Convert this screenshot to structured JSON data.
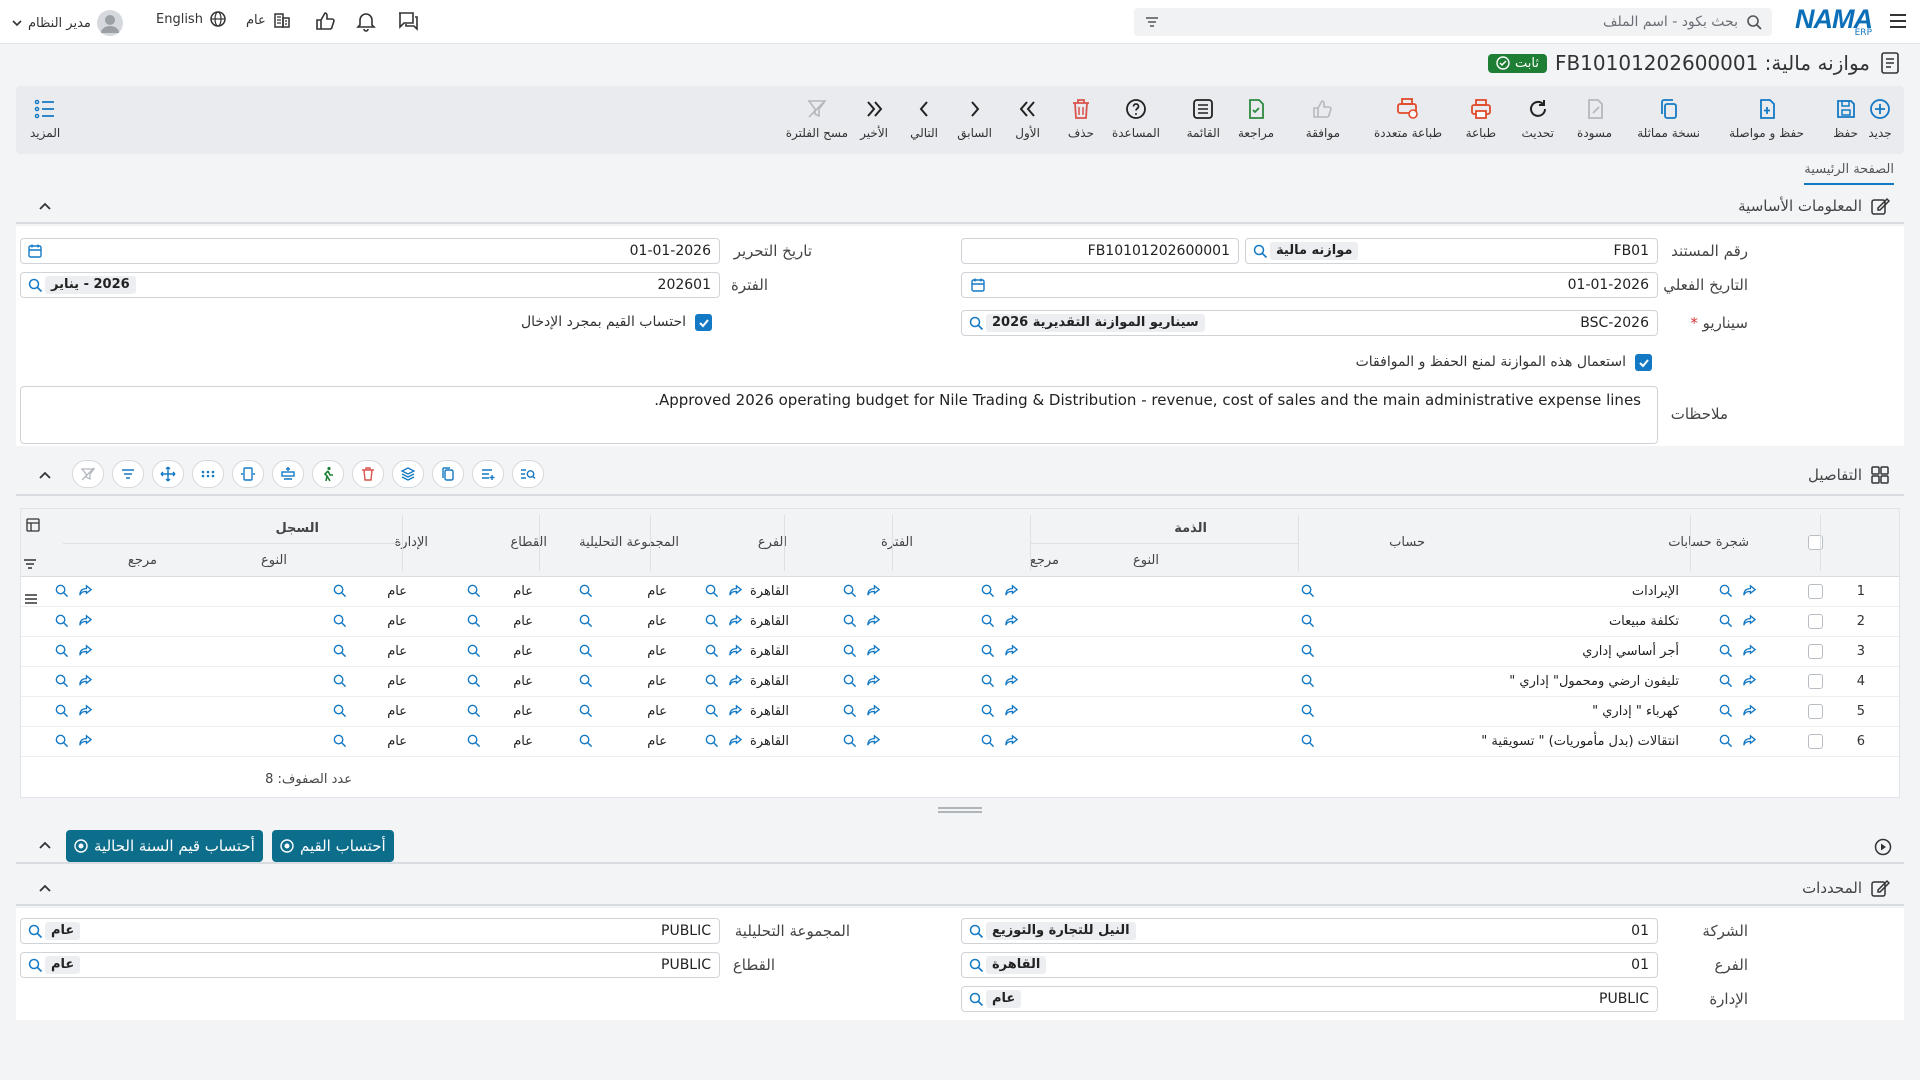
{
  "app": {
    "logo_text": "NAMA",
    "logo_sub": "ERP",
    "search_placeholder": "بحث بكود - اسم الملف",
    "language": "English",
    "scope": "عام",
    "user": "مدير النظام"
  },
  "document": {
    "title": "موازنه مالية: FB10101202600001",
    "status": "ثابت"
  },
  "toolbar": {
    "items": [
      {
        "label": "جديد",
        "icon": "plus-circle-icon"
      },
      {
        "label": "حفظ",
        "icon": "save-icon"
      },
      {
        "label": "حفظ و مواصلة",
        "icon": "save-continue-icon"
      },
      {
        "label": "نسخة مماثلة",
        "icon": "copy-icon"
      },
      {
        "label": "مسودة",
        "icon": "draft-icon"
      },
      {
        "label": "تحديث",
        "icon": "refresh-icon"
      },
      {
        "label": "طباعة",
        "icon": "print-icon"
      },
      {
        "label": "طباعة متعددة",
        "icon": "multi-print-icon"
      },
      {
        "label": "موافقة",
        "icon": "approve-icon"
      },
      {
        "label": "مراجعة",
        "icon": "review-icon"
      },
      {
        "label": "القائمة",
        "icon": "list-icon"
      },
      {
        "label": "المساعدة",
        "icon": "help-icon"
      },
      {
        "label": "حذف",
        "icon": "trash-icon"
      },
      {
        "label": "الأول",
        "icon": "first-icon"
      },
      {
        "label": "السابق",
        "icon": "previous-icon"
      },
      {
        "label": "التالي",
        "icon": "next-icon"
      },
      {
        "label": "الأخير",
        "icon": "last-icon"
      },
      {
        "label": "مسح الفلترة",
        "icon": "clear-filter-icon"
      }
    ],
    "more_label": "المزيد"
  },
  "tabs": {
    "main": "الصفحة الرئيسية"
  },
  "basic_info": {
    "header": "المعلومات الأساسية",
    "doc_number_label": "رقم المستند",
    "doc_type_code": "FB01",
    "doc_type_name": "موازنه مالية",
    "doc_number": "FB10101202600001",
    "edit_date_label": "تاريخ التحرير",
    "edit_date": "01-01-2026",
    "actual_date_label": "التاريخ الفعلي",
    "actual_date": "01-01-2026",
    "period_label": "الفترة",
    "period_code": "202601",
    "period_name": "2026 - يناير",
    "scenario_label": "سيناريو",
    "scenario_code": "BSC-2026",
    "scenario_name": "سيناريو الموازنة التقديرية 2026",
    "calc_on_entry_label": "احتساب القيم بمجرد الإدخال",
    "block_save_label": "استعمال هذه الموازنة لمنع الحفظ و الموافقات",
    "notes_label": "ملاحظات",
    "notes": "Approved 2026 operating budget for Nile Trading & Distribution - revenue, cost of sales and the main administrative expense lines."
  },
  "details": {
    "header": "التفاصيل",
    "groups": {
      "dhimma": "الذمة",
      "sijil": "السجل"
    },
    "columns": {
      "tree": "شجرة حسابات",
      "account": "حساب",
      "type": "النوع",
      "ref": "مرجع",
      "period": "الفترة",
      "branch": "الفرع",
      "analytic": "المجموعة التحليلية",
      "sector": "القطاع",
      "department": "الإدارة",
      "type2": "النوع",
      "ref2": "مرجع"
    },
    "rows": [
      {
        "n": "1",
        "account": "الإيرادات",
        "branch": "القاهرة",
        "analytic": "عام",
        "sector": "عام",
        "department": "عام"
      },
      {
        "n": "2",
        "account": "تكلفة مبيعات",
        "branch": "القاهرة",
        "analytic": "عام",
        "sector": "عام",
        "department": "عام"
      },
      {
        "n": "3",
        "account": "أجر أساسي إداري",
        "branch": "القاهرة",
        "analytic": "عام",
        "sector": "عام",
        "department": "عام"
      },
      {
        "n": "4",
        "account": "تليفون ارضي ومحمول\" إداري \"",
        "branch": "القاهرة",
        "analytic": "عام",
        "sector": "عام",
        "department": "عام"
      },
      {
        "n": "5",
        "account": "كهرباء \" إداري \"",
        "branch": "القاهرة",
        "analytic": "عام",
        "sector": "عام",
        "department": "عام"
      },
      {
        "n": "6",
        "account": "انتقالات (بدل مأموريات) \" تسويقية \"",
        "branch": "القاهرة",
        "analytic": "عام",
        "sector": "عام",
        "department": "عام"
      }
    ],
    "row_count": "عدد الصفوف: 8"
  },
  "actions": {
    "calc_values": "أحتساب القيم",
    "calc_current_year": "أحتساب قيم السنة الحالية"
  },
  "dimensions": {
    "header": "المحددات",
    "company_label": "الشركة",
    "company_code": "01",
    "company_name": "النيل للتجارة والتوزيع",
    "branch_label": "الفرع",
    "branch_code": "01",
    "branch_name": "القاهرة",
    "department_label": "الإدارة",
    "department_code": "PUBLIC",
    "department_name": "عام",
    "analytic_label": "المجموعة التحليلية",
    "analytic_code": "PUBLIC",
    "analytic_name": "عام",
    "sector_label": "القطاع",
    "sector_code": "PUBLIC",
    "sector_name": "عام"
  },
  "colors": {
    "accent": "#1479c4",
    "status_green": "#1e7e34",
    "action_button": "#0d6e8c",
    "delete_red": "#d9534f"
  }
}
